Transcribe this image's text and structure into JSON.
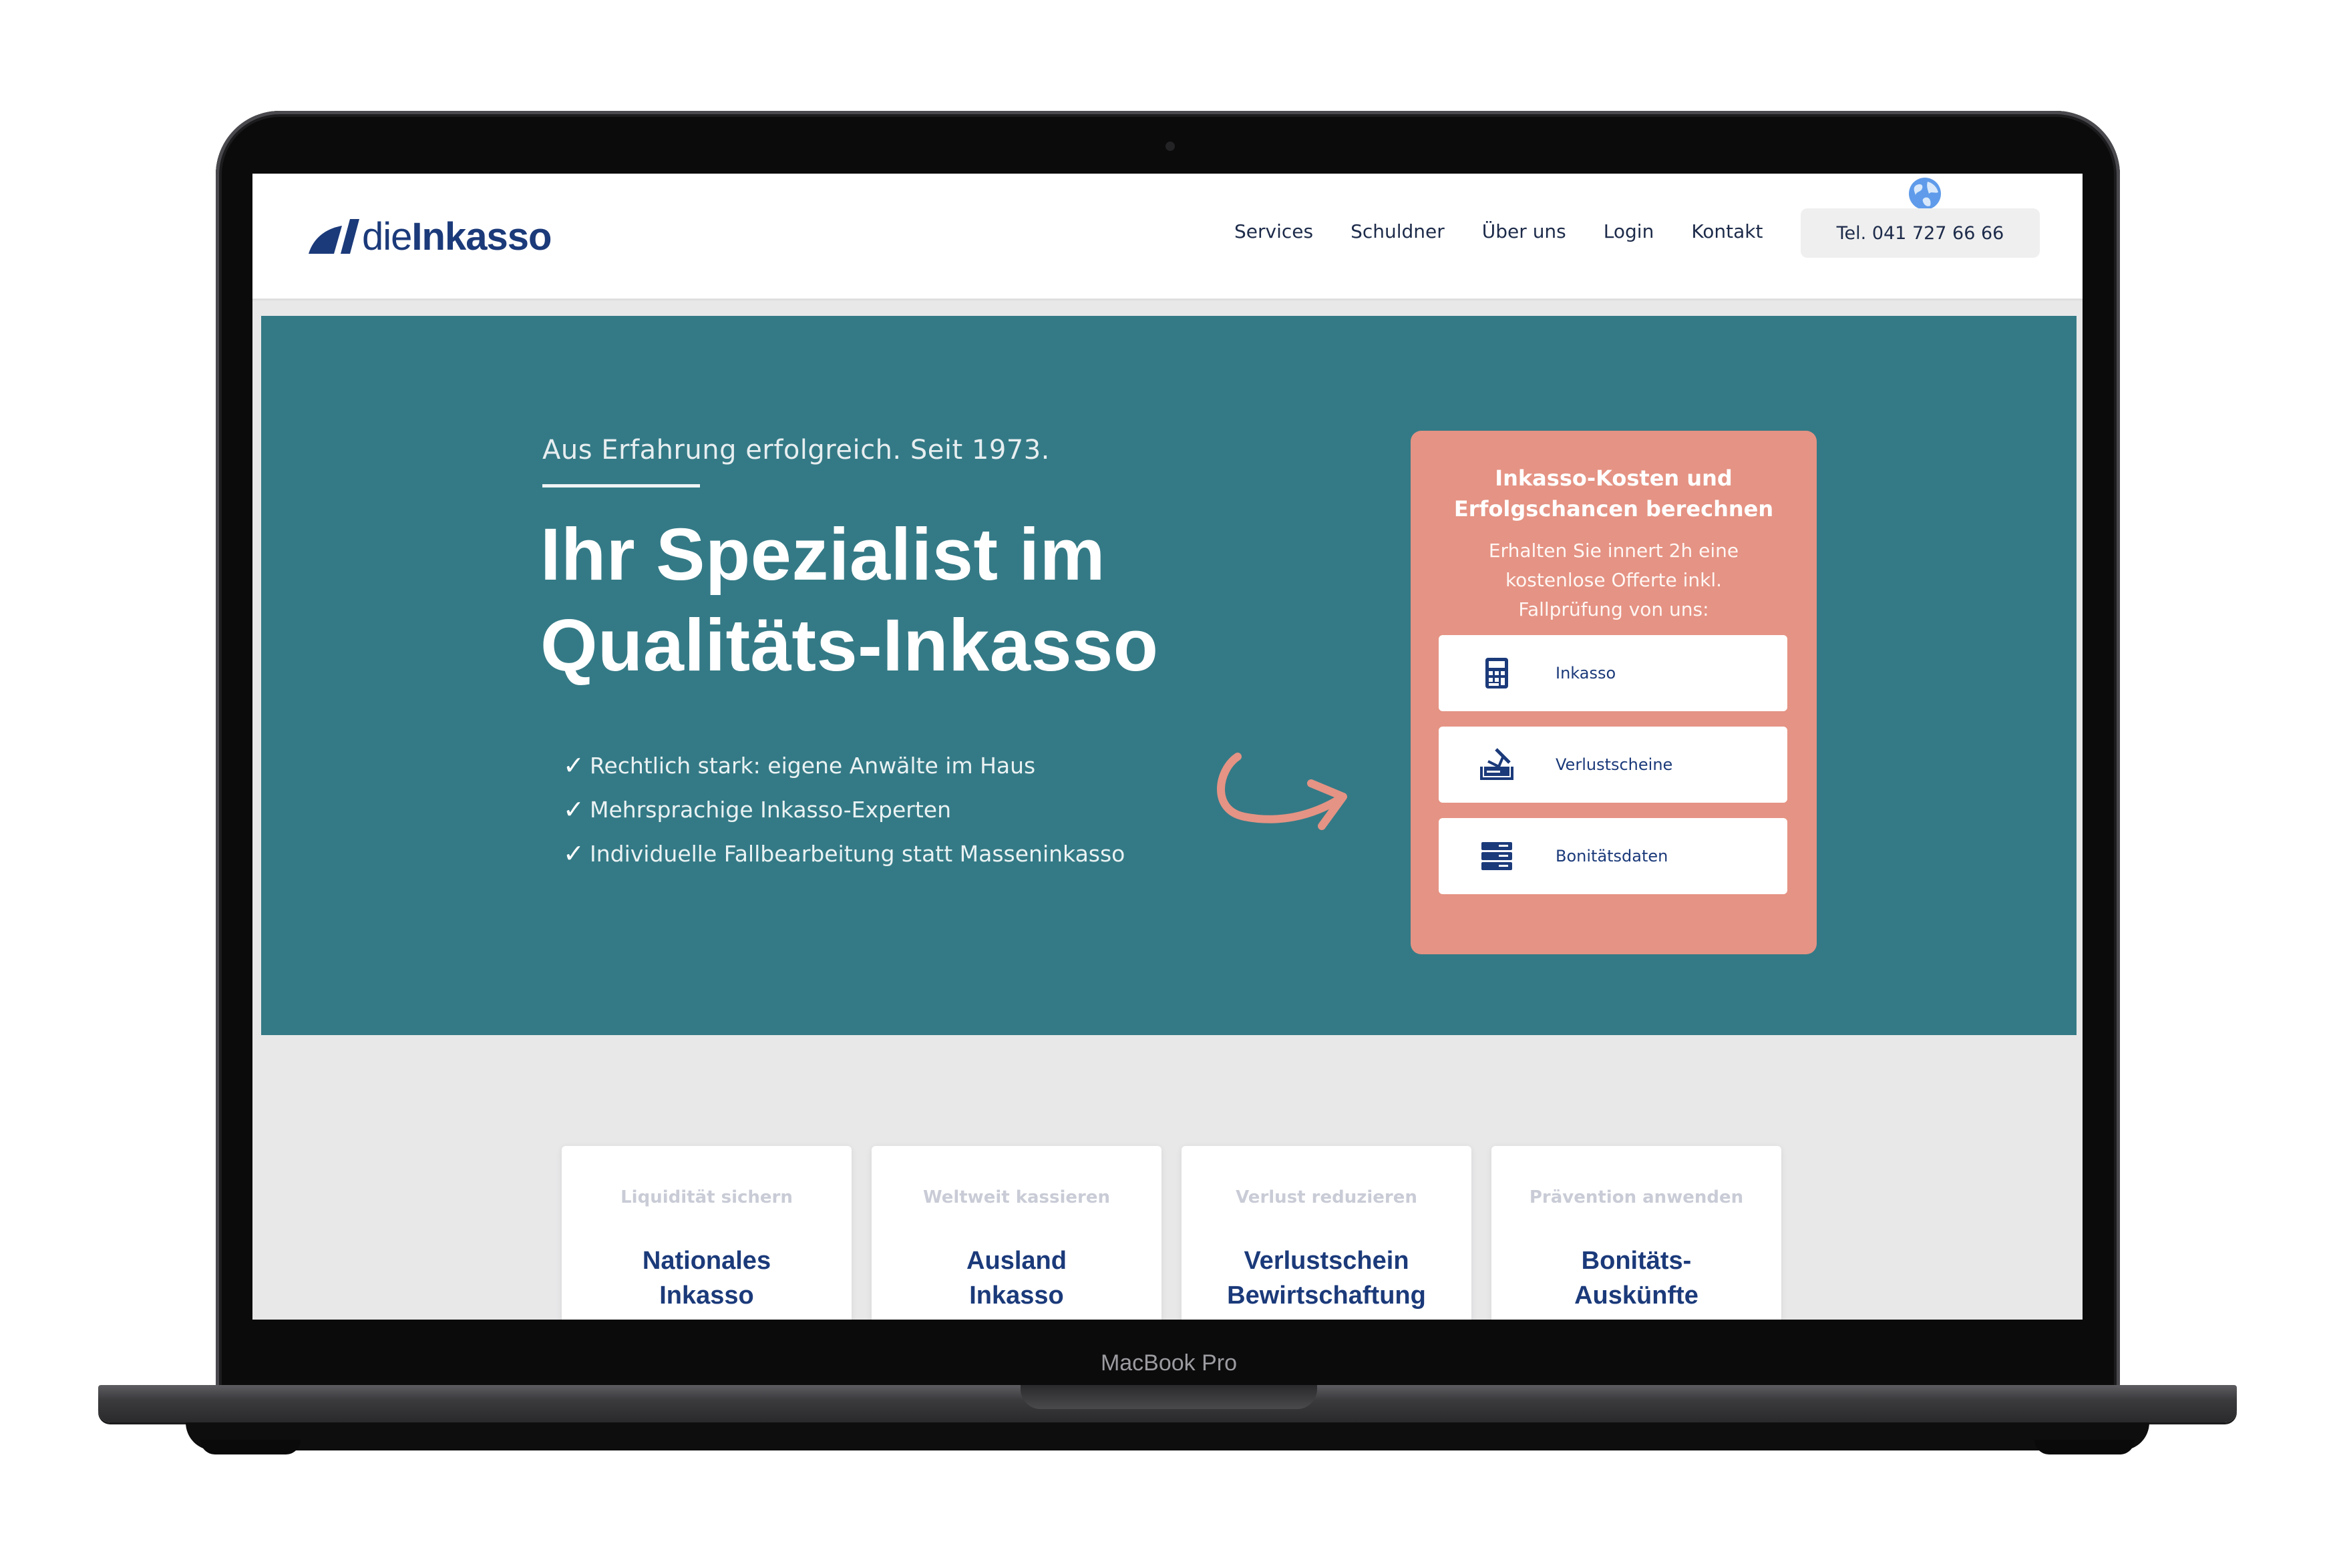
{
  "device": {
    "label": "MacBook Pro"
  },
  "header": {
    "logo": {
      "prefix": "die",
      "name": "Inkasso"
    },
    "nav": [
      "Services",
      "Schuldner",
      "Über uns",
      "Login",
      "Kontakt"
    ],
    "phone": "Tel. 041 727 66 66",
    "language_icon": "globe-icon"
  },
  "hero": {
    "subtitle": "Aus Erfahrung erfolgreich. Seit 1973.",
    "title_line1": "Ihr Spezialist im",
    "title_line2": "Qualitäts-Inkasso",
    "bullets": [
      "Rechtlich stark: eigene Anwälte im Haus",
      "Mehrsprachige Inkasso-Experten",
      "Individuelle Fallbearbeitung statt Masseninkasso"
    ],
    "background_color": "#347a86"
  },
  "calculator": {
    "title_line1": "Inkasso-Kosten und",
    "title_line2": "Erfolgschancen berechnen",
    "text_line1": "Erhalten Sie innert 2h eine",
    "text_line2": "kostenlose Offerte inkl.",
    "text_line3": "Fallprüfung von uns:",
    "options": [
      {
        "label": "Inkasso",
        "icon": "calculator-icon"
      },
      {
        "label": "Verlustscheine",
        "icon": "document-signing-icon"
      },
      {
        "label": "Bonitätsdaten",
        "icon": "server-icon"
      }
    ],
    "color": "#e59384"
  },
  "services": [
    {
      "kicker": "Liquidität sichern",
      "title_line1": "Nationales",
      "title_line2": "Inkasso"
    },
    {
      "kicker": "Weltweit kassieren",
      "title_line1": "Ausland",
      "title_line2": "Inkasso"
    },
    {
      "kicker": "Verlust reduzieren",
      "title_line1": "Verlustschein",
      "title_line2": "Bewirtschaftung"
    },
    {
      "kicker": "Prävention anwenden",
      "title_line1": "Bonitäts-",
      "title_line2": "Auskünfte"
    }
  ],
  "brand_color": "#1b3a7a"
}
